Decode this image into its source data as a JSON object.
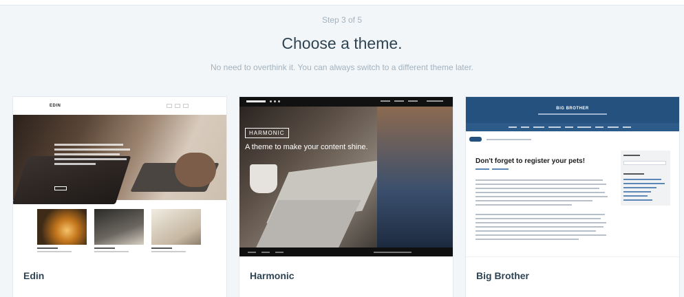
{
  "header": {
    "step": "Step 3 of 5",
    "title": "Choose a theme.",
    "subtitle": "No need to overthink it. You can always switch to a different theme later."
  },
  "themes": [
    {
      "name": "Edin",
      "preview": {
        "logo": "EDIN"
      }
    },
    {
      "name": "Harmonic",
      "preview": {
        "badge": "HARMONIC",
        "tagline": "A theme to make your content shine."
      }
    },
    {
      "name": "Big Brother",
      "preview": {
        "site_title": "BIG BROTHER",
        "post_title": "Don't forget to register your pets!"
      }
    }
  ],
  "colors": {
    "page_background": "#f3f6f8",
    "title_text": "#2e4453",
    "muted_text": "#a2b2bf",
    "big_brother_header": "#24517e"
  }
}
